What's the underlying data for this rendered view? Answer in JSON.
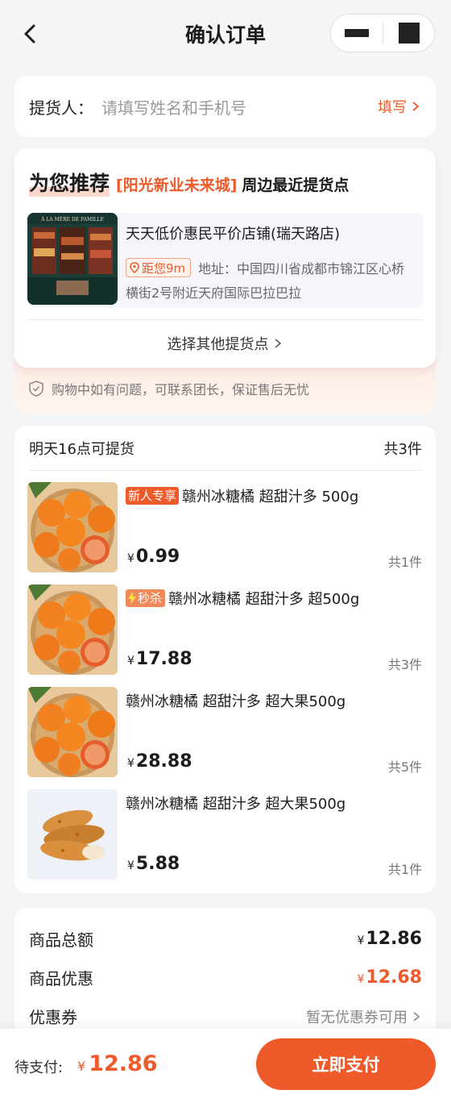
{
  "nav": {
    "title": "确认订单"
  },
  "pickup": {
    "label": "提货人：",
    "placeholder": "请填写姓名和手机号",
    "action": "填写"
  },
  "recommend": {
    "title": "为您推荐",
    "city": "[阳光新业未来城]",
    "near": "周边最近提货点",
    "store": {
      "name": "天天低价惠民平价店铺(瑞天路店)",
      "distance": "距您9m",
      "address": "地址：中国四川省成都市锦江区心桥横街2号附近天府国际巴拉巴拉",
      "sign": "À LA MÈRE DE FAMILLE"
    },
    "other": "选择其他提货点",
    "guarantee": "购物中如有问题，可联系团长，保证售后无忧"
  },
  "items": {
    "pickup_time": "明天16点可提货",
    "count": "共3件",
    "currency": "¥",
    "list": [
      {
        "tag": "新人专享",
        "tag_type": "new",
        "title": "赣州冰糖橘 超甜汁多 500g",
        "price": "0.99",
        "qty": "共1件",
        "image": "orange-icon"
      },
      {
        "tag": "秒杀",
        "tag_type": "flash",
        "title": "赣州冰糖橘 超甜汁多 超500g",
        "price": "17.88",
        "qty": "共3件",
        "image": "orange-icon"
      },
      {
        "tag": "",
        "tag_type": "",
        "title": "赣州冰糖橘 超甜汁多 超大果500g",
        "price": "28.88",
        "qty": "共5件",
        "image": "orange-icon"
      },
      {
        "tag": "",
        "tag_type": "",
        "title": "赣州冰糖橘 超甜汁多 超大果500g",
        "price": "5.88",
        "qty": "共1件",
        "image": "fried-chicken-icon"
      }
    ]
  },
  "summary": {
    "total_label": "商品总额",
    "total": "12.86",
    "discount_label": "商品优惠",
    "discount": "12.68",
    "coupon_label": "优惠券",
    "coupon": "暂无优惠券可用"
  },
  "footer": {
    "pay_label": "待支付:",
    "currency": "¥",
    "amount": "12.86",
    "button": "立即支付"
  },
  "colors": {
    "accent": "#ee5a2a",
    "background": "#f4f5f7"
  }
}
